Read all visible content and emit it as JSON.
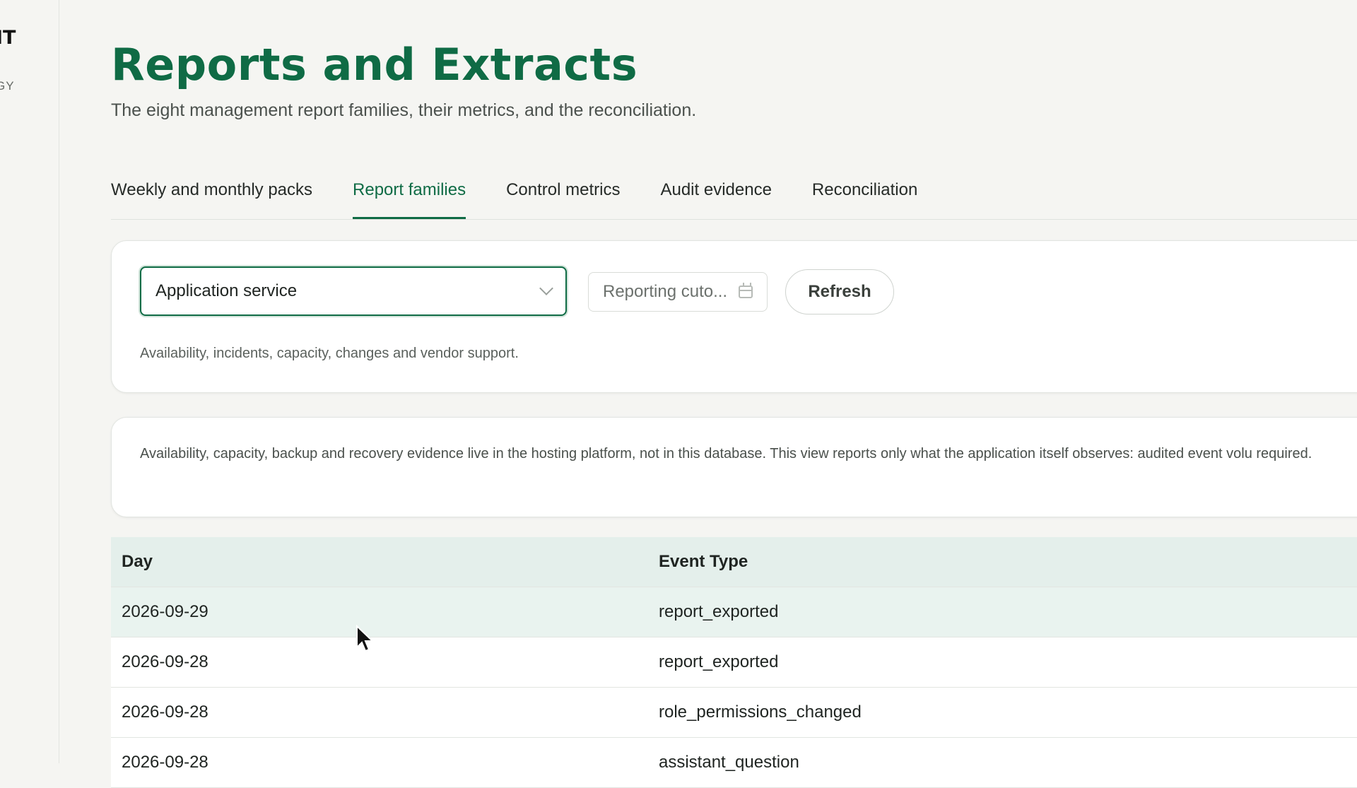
{
  "sidebar": {
    "brand": "IT",
    "brand_sub": "GY"
  },
  "header": {
    "title": "Reports and Extracts",
    "subtitle": "The eight management report families, their metrics, and the reconciliation."
  },
  "tabs": [
    {
      "label": "Weekly and monthly packs",
      "active": false
    },
    {
      "label": "Report families",
      "active": true
    },
    {
      "label": "Control metrics",
      "active": false
    },
    {
      "label": "Audit evidence",
      "active": false
    },
    {
      "label": "Reconciliation",
      "active": false
    }
  ],
  "filters": {
    "family_select": {
      "value": "Application service"
    },
    "cutoff": {
      "placeholder": "Reporting cuto..."
    },
    "refresh_label": "Refresh",
    "description": "Availability, incidents, capacity, changes and vendor support."
  },
  "info": {
    "text": "Availability, capacity, backup and recovery evidence live in the hosting platform, not in this database. This view reports only what the application itself observes: audited event volu required."
  },
  "table": {
    "columns": [
      "Day",
      "Event Type"
    ],
    "rows": [
      [
        "2026-09-29",
        "report_exported"
      ],
      [
        "2026-09-28",
        "report_exported"
      ],
      [
        "2026-09-28",
        "role_permissions_changed"
      ],
      [
        "2026-09-28",
        "assistant_question"
      ]
    ]
  },
  "colors": {
    "accent": "#0f6b45",
    "header_row": "#e4efeb",
    "background": "#f5f5f2"
  }
}
